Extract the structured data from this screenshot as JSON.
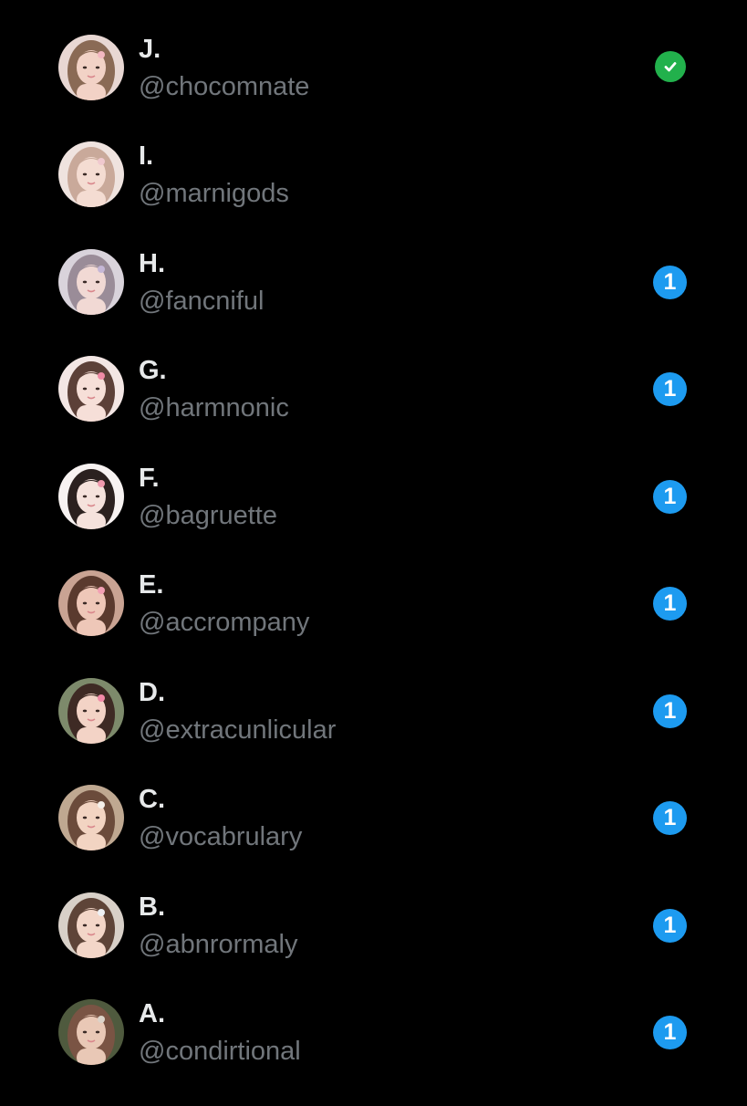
{
  "accounts": [
    {
      "name": "J.",
      "handle": "@chocomnate",
      "status": "check",
      "avatar": {
        "skin": "#f2d2c6",
        "hair": "#8a6a55",
        "bg": "#e8d7d3",
        "accent": "#f3b8c1"
      }
    },
    {
      "name": "I.",
      "handle": "@marnigods",
      "status": "none",
      "avatar": {
        "skin": "#f4dcd2",
        "hair": "#c9a99a",
        "bg": "#efe3df",
        "accent": "#f0c9cf"
      }
    },
    {
      "name": "H.",
      "handle": "@fancniful",
      "status": "count",
      "count": "1",
      "avatar": {
        "skin": "#f1d9d4",
        "hair": "#9a8c98",
        "bg": "#d9d3db",
        "accent": "#c5b7d6"
      }
    },
    {
      "name": "G.",
      "handle": "@harmnonic",
      "status": "count",
      "count": "1",
      "avatar": {
        "skin": "#f6dfd8",
        "hair": "#5c4038",
        "bg": "#f3e6e4",
        "accent": "#f08aa5"
      }
    },
    {
      "name": "F.",
      "handle": "@bagruette",
      "status": "count",
      "count": "1",
      "avatar": {
        "skin": "#f5e2dc",
        "hair": "#2b211f",
        "bg": "#f7f2f1",
        "accent": "#f09aae"
      }
    },
    {
      "name": "E.",
      "handle": "@accrompany",
      "status": "count",
      "count": "1",
      "avatar": {
        "skin": "#eec7b8",
        "hair": "#5a3a2e",
        "bg": "#c9a393",
        "accent": "#f2a0b4"
      }
    },
    {
      "name": "D.",
      "handle": "@extracunlicular",
      "status": "count",
      "count": "1",
      "avatar": {
        "skin": "#f3d3c6",
        "hair": "#3e2a24",
        "bg": "#7d8a6b",
        "accent": "#f28aa8"
      }
    },
    {
      "name": "C.",
      "handle": "@vocabrulary",
      "status": "count",
      "count": "1",
      "avatar": {
        "skin": "#f2d4c2",
        "hair": "#6b4b3b",
        "bg": "#bfa891",
        "accent": "#f4efe9"
      }
    },
    {
      "name": "B.",
      "handle": "@abnrormaly",
      "status": "count",
      "count": "1",
      "avatar": {
        "skin": "#f3d6c8",
        "hair": "#5e4438",
        "bg": "#d8d0c8",
        "accent": "#eef1f5"
      }
    },
    {
      "name": "A.",
      "handle": "@condirtional",
      "status": "count",
      "count": "1",
      "avatar": {
        "skin": "#e9c8b6",
        "hair": "#7a5444",
        "bg": "#4f5a3e",
        "accent": "#dcd3c9"
      }
    }
  ],
  "colors": {
    "background": "#000000",
    "name_text": "#e7e9ea",
    "handle_text": "#71767b",
    "count_badge": "#1d9bf0",
    "check_badge": "#22b14c"
  }
}
